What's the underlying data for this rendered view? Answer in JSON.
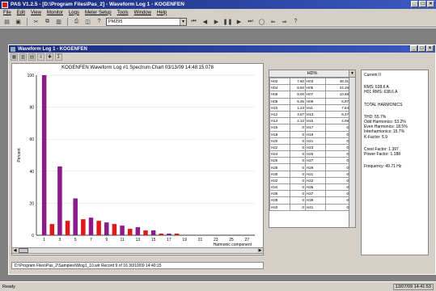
{
  "app": {
    "title": "PAS V1.2.5 - [D:\\Program Files\\Pas_2] - Waveform Log 1 - KOGENFEN",
    "win_buttons": [
      "_",
      "□",
      "×"
    ]
  },
  "menu": [
    "File",
    "Edit",
    "View",
    "Monitor",
    "Logs",
    "Meter Setup",
    "Tools",
    "Window",
    "Help"
  ],
  "toolbar": {
    "icons": [
      "open-icon",
      "save-icon",
      "cut-icon",
      "copy-icon",
      "paste-icon",
      "print-icon",
      "print-preview-icon",
      "help-icon"
    ],
    "combo_value": "PM295",
    "nav_icons": [
      "first-icon",
      "prev-icon",
      "play-icon",
      "pause-icon",
      "next-icon",
      "last-icon",
      "stop-icon",
      "rewind-icon",
      "forward-icon"
    ]
  },
  "child_window": {
    "title": "Waveform Log 1 - KOGENFEN",
    "toolbar_icons": [
      "chart-icon",
      "bar-icon",
      "table-icon",
      "list-icon",
      "star-icon",
      "sigma-icon"
    ]
  },
  "chart_data": {
    "type": "bar",
    "title": "KOGENFEN Waveform Log #1 Spectrum Chart 03/13/09 14:48:15.078",
    "ylabel": "Percent",
    "xlabel": "Harmonic component",
    "ylim": [
      0,
      100
    ],
    "yticks": [
      0,
      20,
      40,
      60,
      80,
      100
    ],
    "xticks": [
      1,
      3,
      5,
      7,
      9,
      11,
      13,
      15,
      17,
      19,
      21,
      23,
      25,
      27
    ],
    "series": [
      {
        "name": "",
        "color": "#8b1a8b",
        "values": [
          {
            "x": 1,
            "y": 100
          },
          {
            "x": 3,
            "y": 43
          },
          {
            "x": 5,
            "y": 23
          },
          {
            "x": 7,
            "y": 11
          },
          {
            "x": 9,
            "y": 8
          },
          {
            "x": 11,
            "y": 6
          },
          {
            "x": 13,
            "y": 5
          },
          {
            "x": 15,
            "y": 3
          },
          {
            "x": 17,
            "y": 1
          }
        ]
      },
      {
        "name": "",
        "color": "#e01818",
        "values": [
          {
            "x": 2,
            "y": 7
          },
          {
            "x": 4,
            "y": 9
          },
          {
            "x": 6,
            "y": 10
          },
          {
            "x": 8,
            "y": 9
          },
          {
            "x": 10,
            "y": 7
          },
          {
            "x": 12,
            "y": 4
          },
          {
            "x": 14,
            "y": 3
          },
          {
            "x": 16,
            "y": 1
          },
          {
            "x": 18,
            "y": 1
          }
        ]
      }
    ]
  },
  "hd_table": {
    "header": "HD%",
    "rows": [
      [
        "H02",
        "7.60",
        "H03",
        "48.31"
      ],
      [
        "H04",
        "8.50",
        "H05",
        "24.28"
      ],
      [
        "H06",
        "9.00",
        "H07",
        "10.58"
      ],
      [
        "H08",
        "5.35",
        "H09",
        "5.97"
      ],
      [
        "H10",
        "1.23",
        "H11",
        "7.84"
      ],
      [
        "H12",
        "3.07",
        "H13",
        "6.37"
      ],
      [
        "H14",
        "2.12",
        "H15",
        "4.08"
      ],
      [
        "H16",
        "0",
        "H17",
        "0"
      ],
      [
        "H18",
        "0",
        "H19",
        "0"
      ],
      [
        "H20",
        "0",
        "H21",
        "0"
      ],
      [
        "H22",
        "0",
        "H23",
        "0"
      ],
      [
        "H24",
        "0",
        "H25",
        "0"
      ],
      [
        "H26",
        "0",
        "H27",
        "0"
      ],
      [
        "H28",
        "0",
        "H29",
        "0"
      ],
      [
        "H30",
        "0",
        "H31",
        "0"
      ],
      [
        "H32",
        "0",
        "H33",
        "0"
      ],
      [
        "H34",
        "0",
        "H35",
        "0"
      ],
      [
        "H36",
        "0",
        "H37",
        "0"
      ],
      [
        "H38",
        "0",
        "H39",
        "0"
      ],
      [
        "H40",
        "0",
        "H41",
        "0"
      ]
    ]
  },
  "info": {
    "current": "Current II",
    "rms": "RMS: 638.6 A",
    "h01_rms": "H01 RMS: 638.6 A",
    "total_harmonics": "TOTAL HARMONICS",
    "thd": "THD: 55.7%",
    "odd": "Odd Harmonics: 53.2%",
    "even": "Even Harmonics: 18.5%",
    "interharmonics": "Interharmonics: 15.7%",
    "kfactor": "K-Factor: 5.9",
    "crest": "Crest Factor: 1.397",
    "power_factor": "Power Factor: 1.188",
    "frequency": "Frequency: 49.71 Hz"
  },
  "path_bar": "D:\\Program Files\\Pas_2\\Samples\\Wlog1_10.wlr  Record 9 of 16  30/10/09 14:40:15",
  "status": {
    "left": "Ready",
    "right": "13/07/09 14:41:53"
  }
}
